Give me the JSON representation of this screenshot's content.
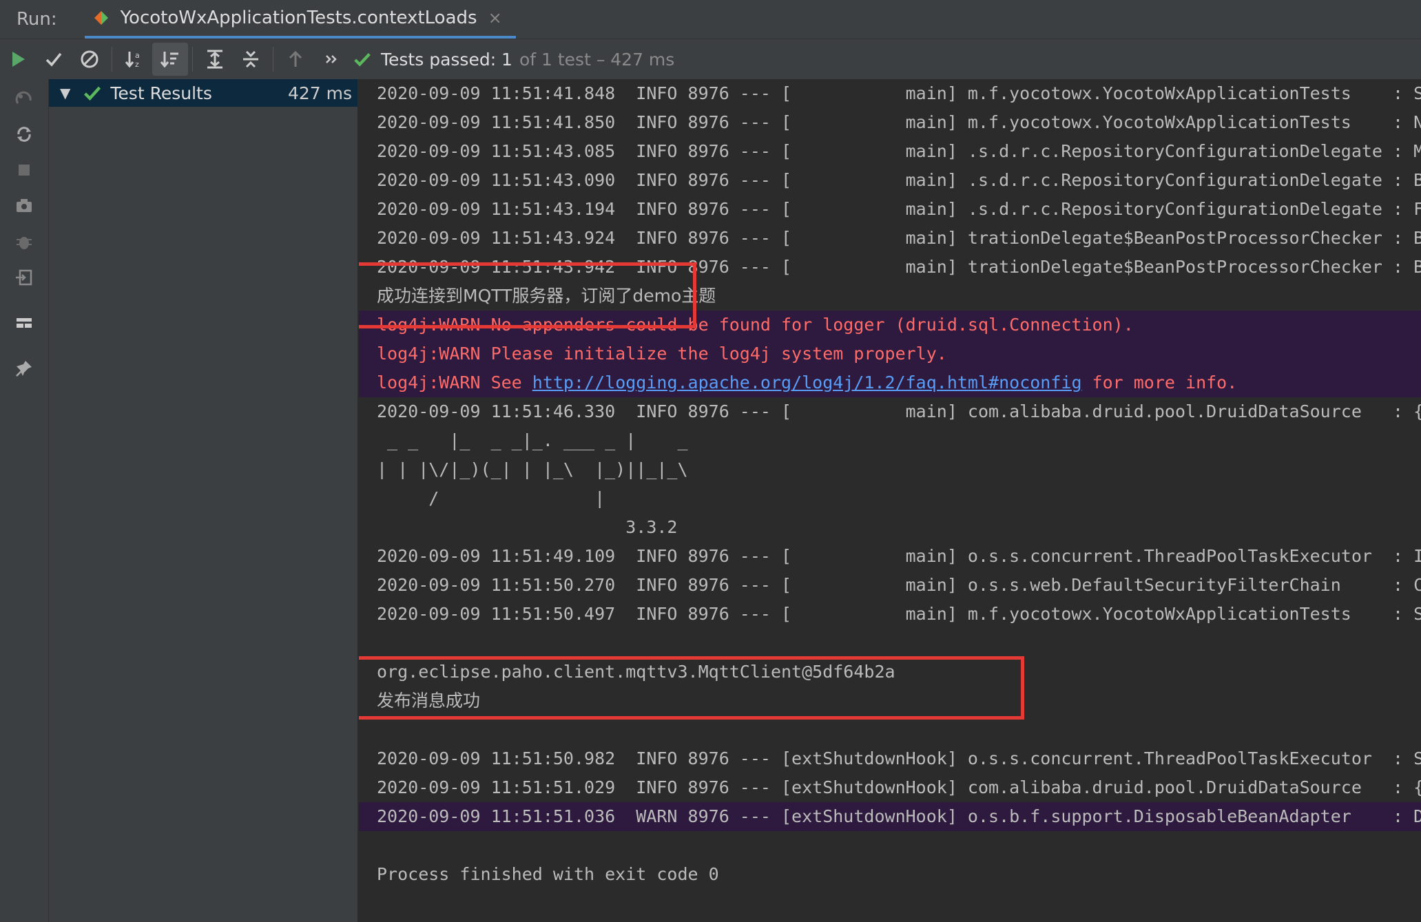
{
  "tabbar": {
    "run_label": "Run:",
    "tab_label": "YocotoWxApplicationTests.contextLoads",
    "close_glyph": "×"
  },
  "toolbar": {
    "status_bold": "Tests passed: 1",
    "status_dim": "of 1 test – 427 ms"
  },
  "tree": {
    "root_label": "Test Results",
    "root_duration": "427 ms"
  },
  "console": {
    "lines": [
      {
        "text": "2020-09-09 11:51:41.848  INFO 8976 --- [           main] m.f.yocotowx.YocotoWxApplicationTests    : S",
        "style": "normal"
      },
      {
        "text": "2020-09-09 11:51:41.850  INFO 8976 --- [           main] m.f.yocotowx.YocotoWxApplicationTests    : N",
        "style": "normal"
      },
      {
        "text": "2020-09-09 11:51:43.085  INFO 8976 --- [           main] .s.d.r.c.RepositoryConfigurationDelegate : M",
        "style": "normal"
      },
      {
        "text": "2020-09-09 11:51:43.090  INFO 8976 --- [           main] .s.d.r.c.RepositoryConfigurationDelegate : B",
        "style": "normal"
      },
      {
        "text": "2020-09-09 11:51:43.194  INFO 8976 --- [           main] .s.d.r.c.RepositoryConfigurationDelegate : F",
        "style": "normal"
      },
      {
        "text": "2020-09-09 11:51:43.924  INFO 8976 --- [           main] trationDelegate$BeanPostProcessorChecker : B",
        "style": "normal"
      },
      {
        "text": "2020-09-09 11:51:43.942  INFO 8976 --- [           main] trationDelegate$BeanPostProcessorChecker : B",
        "style": "normal"
      },
      {
        "text": "成功连接到MQTT服务器，订阅了demo主题",
        "style": "cjk"
      },
      {
        "text": "log4j:WARN No appenders could be found for logger (druid.sql.Connection).",
        "style": "err"
      },
      {
        "text": "log4j:WARN Please initialize the log4j system properly.",
        "style": "err"
      },
      {
        "text": "log4j:WARN See ",
        "link": "http://logging.apache.org/log4j/1.2/faq.html#noconfig",
        "suffix": " for more info.",
        "style": "err"
      },
      {
        "text": "2020-09-09 11:51:46.330  INFO 8976 --- [           main] com.alibaba.druid.pool.DruidDataSource   : {",
        "style": "normal"
      },
      {
        "text": " _ _   |_  _ _|_. ___ _ |    _",
        "style": "normal"
      },
      {
        "text": "| | |\\/|_)(_| | |_\\  |_)||_|_\\",
        "style": "normal"
      },
      {
        "text": "     /               |",
        "style": "normal"
      },
      {
        "text": "                        3.3.2",
        "style": "normal"
      },
      {
        "text": "2020-09-09 11:51:49.109  INFO 8976 --- [           main] o.s.s.concurrent.ThreadPoolTaskExecutor  : I",
        "style": "normal"
      },
      {
        "text": "2020-09-09 11:51:50.270  INFO 8976 --- [           main] o.s.s.web.DefaultSecurityFilterChain     : C",
        "style": "normal"
      },
      {
        "text": "2020-09-09 11:51:50.497  INFO 8976 --- [           main] m.f.yocotowx.YocotoWxApplicationTests    : S",
        "style": "normal"
      },
      {
        "text": "",
        "style": "normal"
      },
      {
        "text": "org.eclipse.paho.client.mqttv3.MqttClient@5df64b2a",
        "style": "normal"
      },
      {
        "text": "发布消息成功",
        "style": "cjk"
      },
      {
        "text": "",
        "style": "normal"
      },
      {
        "text": "2020-09-09 11:51:50.982  INFO 8976 --- [extShutdownHook] o.s.s.concurrent.ThreadPoolTaskExecutor  : S",
        "style": "normal"
      },
      {
        "text": "2020-09-09 11:51:51.029  INFO 8976 --- [extShutdownHook] com.alibaba.druid.pool.DruidDataSource   : {",
        "style": "normal"
      },
      {
        "text": "2020-09-09 11:51:51.036  WARN 8976 --- [extShutdownHook] o.s.b.f.support.DisposableBeanAdapter    : D",
        "style": "warnbg"
      },
      {
        "text": "",
        "style": "normal"
      },
      {
        "text": "Process finished with exit code 0",
        "style": "normal"
      }
    ]
  },
  "colors": {
    "accent": "#4a88c7",
    "pass_green": "#5cb85c",
    "error_red": "#ff6b68",
    "highlight_box": "#e53935",
    "link_blue": "#589df6"
  },
  "icons": {
    "toolbar": [
      "play-icon",
      "check-icon",
      "stop-circle-icon",
      "sort-alpha-icon",
      "sort-duration-icon",
      "expand-all-icon",
      "collapse-all-icon",
      "up-arrow-icon",
      "more-icon"
    ],
    "left_strip": [
      "rerun-failed-icon",
      "toggle-auto-test-icon",
      "stop-icon",
      "camera-icon",
      "bug-icon",
      "import-icon",
      "layout-icon",
      "pin-icon"
    ]
  }
}
